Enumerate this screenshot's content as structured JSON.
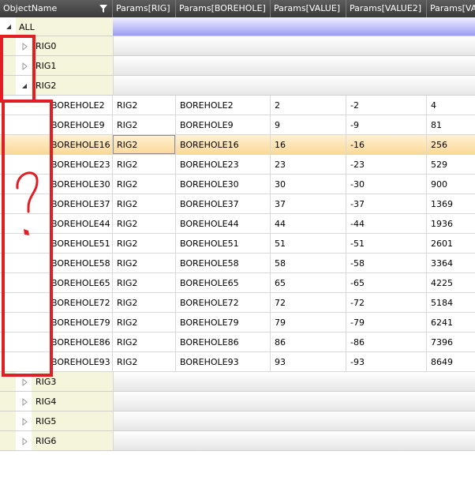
{
  "columns": [
    "ObjectName",
    "Params[RIG]",
    "Params[BOREHOLE]",
    "Params[VALUE]",
    "Params[VALUE2]",
    "Params[VALUE"
  ],
  "root": {
    "label": "ALL"
  },
  "groups_before": [
    {
      "label": "RIG0"
    },
    {
      "label": "RIG1"
    }
  ],
  "expanded_group": {
    "label": "RIG2"
  },
  "rows": [
    {
      "name": "BOREHOLE2",
      "rig": "RIG2",
      "borehole": "BOREHOLE2",
      "value": "2",
      "value2": "-2",
      "value3": "4"
    },
    {
      "name": "BOREHOLE9",
      "rig": "RIG2",
      "borehole": "BOREHOLE9",
      "value": "9",
      "value2": "-9",
      "value3": "81"
    },
    {
      "name": "BOREHOLE16",
      "rig": "RIG2",
      "borehole": "BOREHOLE16",
      "value": "16",
      "value2": "-16",
      "value3": "256"
    },
    {
      "name": "BOREHOLE23",
      "rig": "RIG2",
      "borehole": "BOREHOLE23",
      "value": "23",
      "value2": "-23",
      "value3": "529"
    },
    {
      "name": "BOREHOLE30",
      "rig": "RIG2",
      "borehole": "BOREHOLE30",
      "value": "30",
      "value2": "-30",
      "value3": "900"
    },
    {
      "name": "BOREHOLE37",
      "rig": "RIG2",
      "borehole": "BOREHOLE37",
      "value": "37",
      "value2": "-37",
      "value3": "1369"
    },
    {
      "name": "BOREHOLE44",
      "rig": "RIG2",
      "borehole": "BOREHOLE44",
      "value": "44",
      "value2": "-44",
      "value3": "1936"
    },
    {
      "name": "BOREHOLE51",
      "rig": "RIG2",
      "borehole": "BOREHOLE51",
      "value": "51",
      "value2": "-51",
      "value3": "2601"
    },
    {
      "name": "BOREHOLE58",
      "rig": "RIG2",
      "borehole": "BOREHOLE58",
      "value": "58",
      "value2": "-58",
      "value3": "3364"
    },
    {
      "name": "BOREHOLE65",
      "rig": "RIG2",
      "borehole": "BOREHOLE65",
      "value": "65",
      "value2": "-65",
      "value3": "4225"
    },
    {
      "name": "BOREHOLE72",
      "rig": "RIG2",
      "borehole": "BOREHOLE72",
      "value": "72",
      "value2": "-72",
      "value3": "5184"
    },
    {
      "name": "BOREHOLE79",
      "rig": "RIG2",
      "borehole": "BOREHOLE79",
      "value": "79",
      "value2": "-79",
      "value3": "6241"
    },
    {
      "name": "BOREHOLE86",
      "rig": "RIG2",
      "borehole": "BOREHOLE86",
      "value": "86",
      "value2": "-86",
      "value3": "7396"
    },
    {
      "name": "BOREHOLE93",
      "rig": "RIG2",
      "borehole": "BOREHOLE93",
      "value": "93",
      "value2": "-93",
      "value3": "8649"
    }
  ],
  "selected_row": 2,
  "groups_after": [
    {
      "label": "RIG3"
    },
    {
      "label": "RIG4"
    },
    {
      "label": "RIG5"
    },
    {
      "label": "RIG6"
    }
  ],
  "annotation": {
    "text": "?",
    "color": "#e01e24"
  },
  "icons": {
    "filter": "filter-icon",
    "collapsed": "expand-arrow-icon",
    "expanded": "collapse-arrow-icon"
  }
}
